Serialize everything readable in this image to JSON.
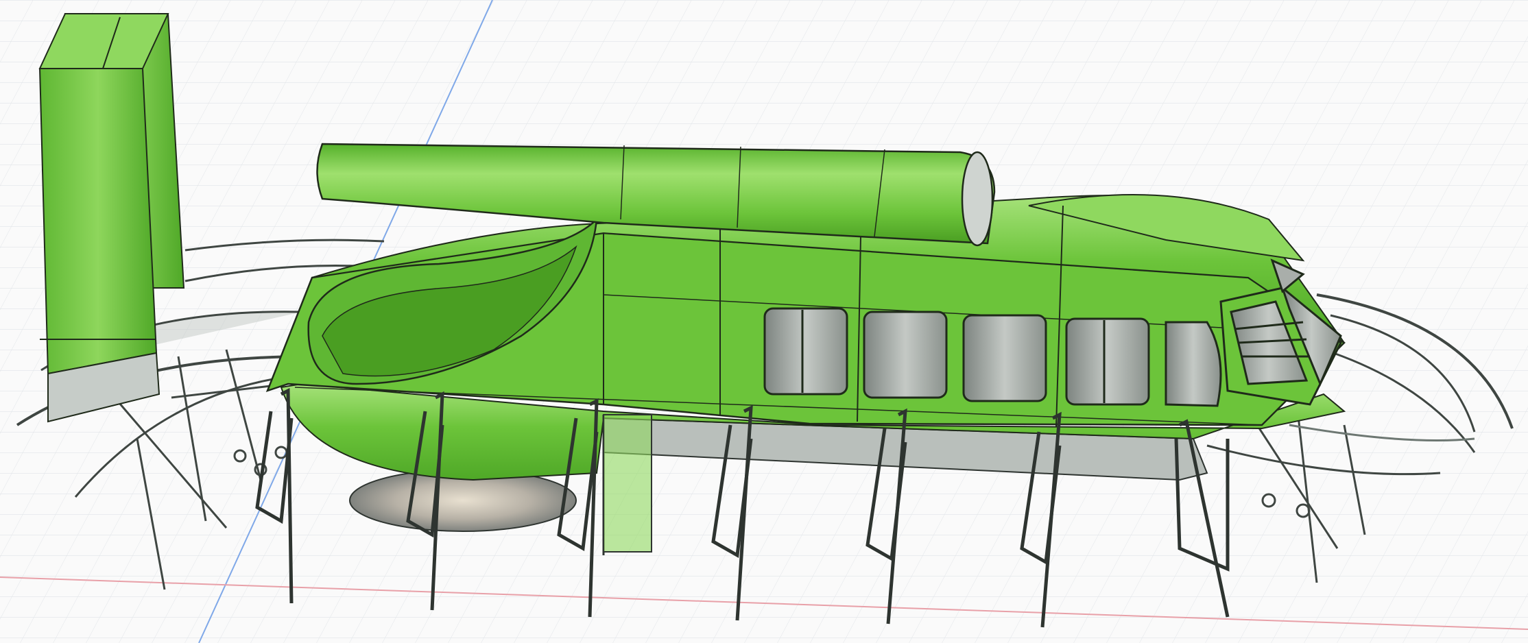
{
  "viewport": {
    "kind": "3d-modeling-canvas",
    "background": "#fafafa",
    "grid_color": "#d9dde2",
    "axis_colors": {
      "x_axis": "#e8a0a8",
      "y_axis": "#7fa8e8"
    }
  },
  "model": {
    "body_color": "#6cc43a",
    "body_shade": "#4fa827",
    "body_highlight": "#a6e27a",
    "edge_color": "#1f2a1a",
    "frame_color": "#7b857f",
    "frame_dark": "#3f4642",
    "glass_color": "#a9aeaa"
  }
}
